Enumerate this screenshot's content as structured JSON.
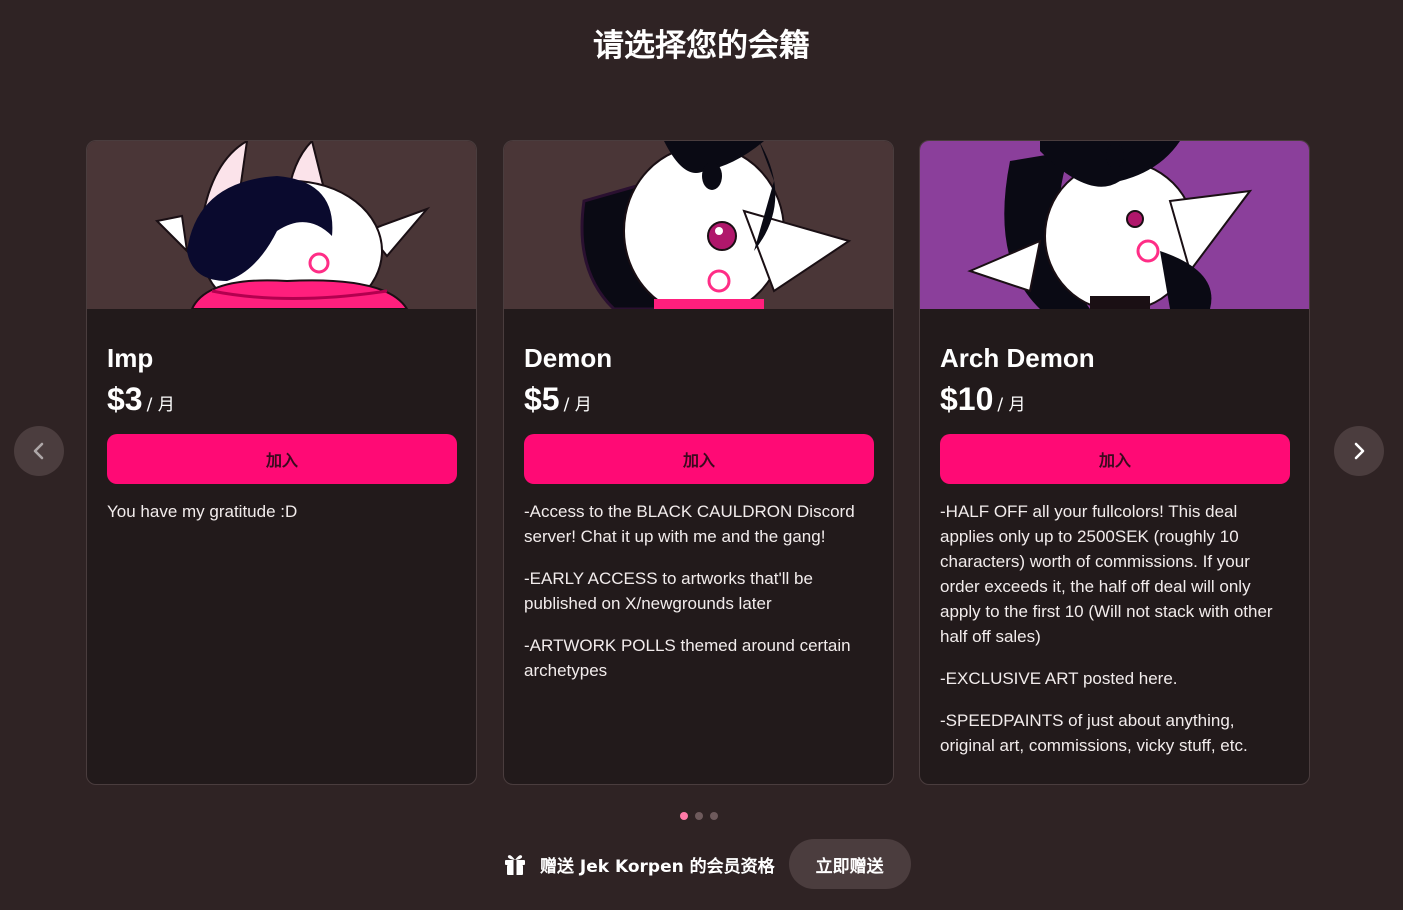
{
  "page": {
    "title": "请选择您的会籍"
  },
  "carousel": {
    "prev_icon": "chevron-left-icon",
    "next_icon": "chevron-right-icon",
    "pages": 3,
    "active_page": 1
  },
  "tiers": [
    {
      "name": "Imp",
      "price": "$3",
      "period": "/ 月",
      "join_label": "加入",
      "banner_color": "#4a3637",
      "benefits": [
        "You have my gratitude :D"
      ]
    },
    {
      "name": "Demon",
      "price": "$5",
      "period": "/ 月",
      "join_label": "加入",
      "banner_color": "#4a3637",
      "benefits": [
        "-Access to the BLACK CAULDRON Discord server! Chat it up with me and the gang!",
        "-EARLY ACCESS to artworks that'll be published on X/newgrounds later",
        "-ARTWORK POLLS themed around certain archetypes"
      ]
    },
    {
      "name": "Arch Demon",
      "price": "$10",
      "period": "/ 月",
      "join_label": "加入",
      "banner_color": "#8b3f9b",
      "benefits": [
        "-HALF OFF all your fullcolors! This deal applies only up to 2500SEK (roughly 10 characters) worth of commissions. If your order exceeds it, the half off deal will only apply to the first 10 (Will not stack with other half off sales)",
        "-EXCLUSIVE ART posted here.",
        "-SPEEDPAINTS of just about anything, original art, commissions, vicky stuff, etc."
      ]
    }
  ],
  "gift": {
    "icon": "gift-icon",
    "text": "赠送 Jek Korpen 的会员资格",
    "button_label": "立即赠送"
  },
  "colors": {
    "background": "#2f2324",
    "card": "#221a1b",
    "accent": "#ff0a75",
    "secondary_button": "#4b3d3e"
  }
}
